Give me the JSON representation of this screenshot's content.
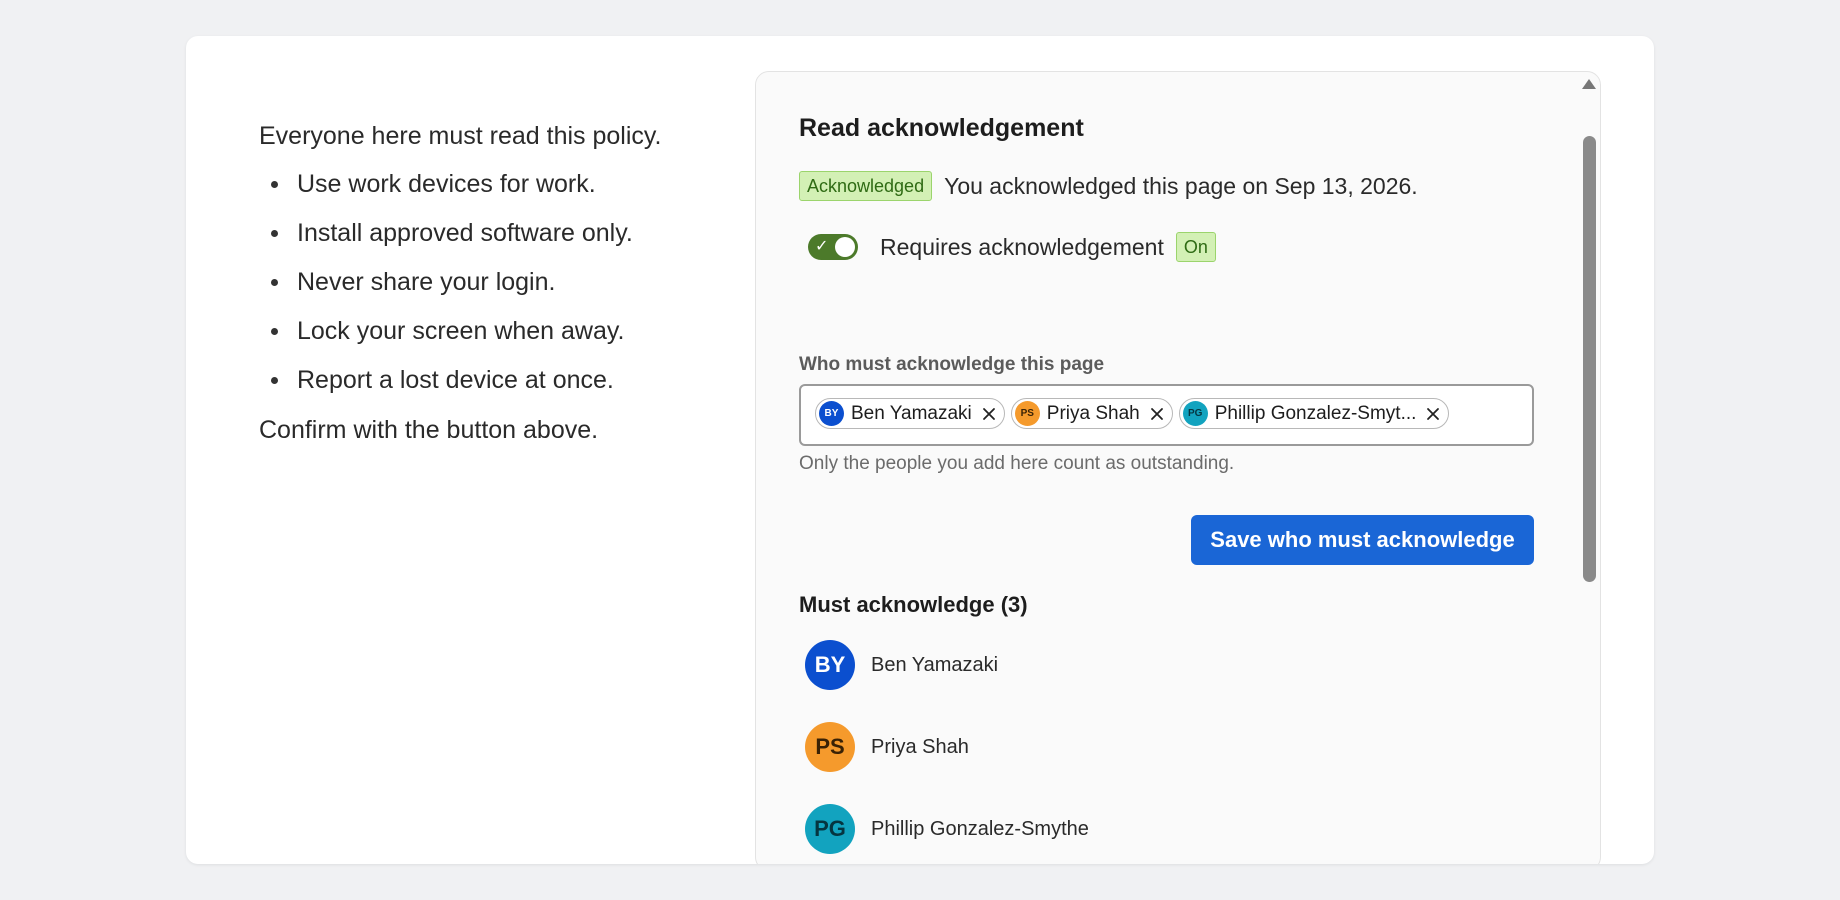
{
  "article": {
    "intro": "Everyone here must read this policy.",
    "bullets": [
      "Use work devices for work.",
      "Install approved software only.",
      "Never share your login.",
      "Lock your screen when away.",
      "Report a lost device at once."
    ],
    "outro": "Confirm with the button above."
  },
  "panel": {
    "title": "Read acknowledgement",
    "status_badge": "Acknowledged",
    "status_text": "You acknowledged this page on Sep 13, 2026.",
    "toggle_label": "Requires acknowledgement",
    "toggle_state": "On",
    "field_label": "Who must acknowledge this page",
    "chips": [
      {
        "initials": "BY",
        "name": "Ben Yamazaki",
        "color": "#0b4fcf",
        "text_color": "#ffffff"
      },
      {
        "initials": "PS",
        "name": "Priya Shah",
        "color": "#f59a2c",
        "text_color": "#3a2205"
      },
      {
        "initials": "PG",
        "name": "Phillip Gonzalez-Smyt...",
        "color": "#12a3bf",
        "text_color": "#053540"
      }
    ],
    "helper": "Only the people you add here count as outstanding.",
    "save_label": "Save who must acknowledge",
    "list_title": "Must acknowledge (3)",
    "people": [
      {
        "initials": "BY",
        "name": "Ben Yamazaki"
      },
      {
        "initials": "PS",
        "name": "Priya Shah"
      },
      {
        "initials": "PG",
        "name": "Phillip Gonzalez-Smythe"
      }
    ]
  },
  "colors": {
    "primary": "#1a66d6",
    "success_bg": "#d3f0b5",
    "toggle_on": "#4c7a2a"
  },
  "icons": {
    "remove_chip": "close-icon",
    "toggle_check": "check-icon",
    "scroll_up": "arrow-up-icon"
  }
}
